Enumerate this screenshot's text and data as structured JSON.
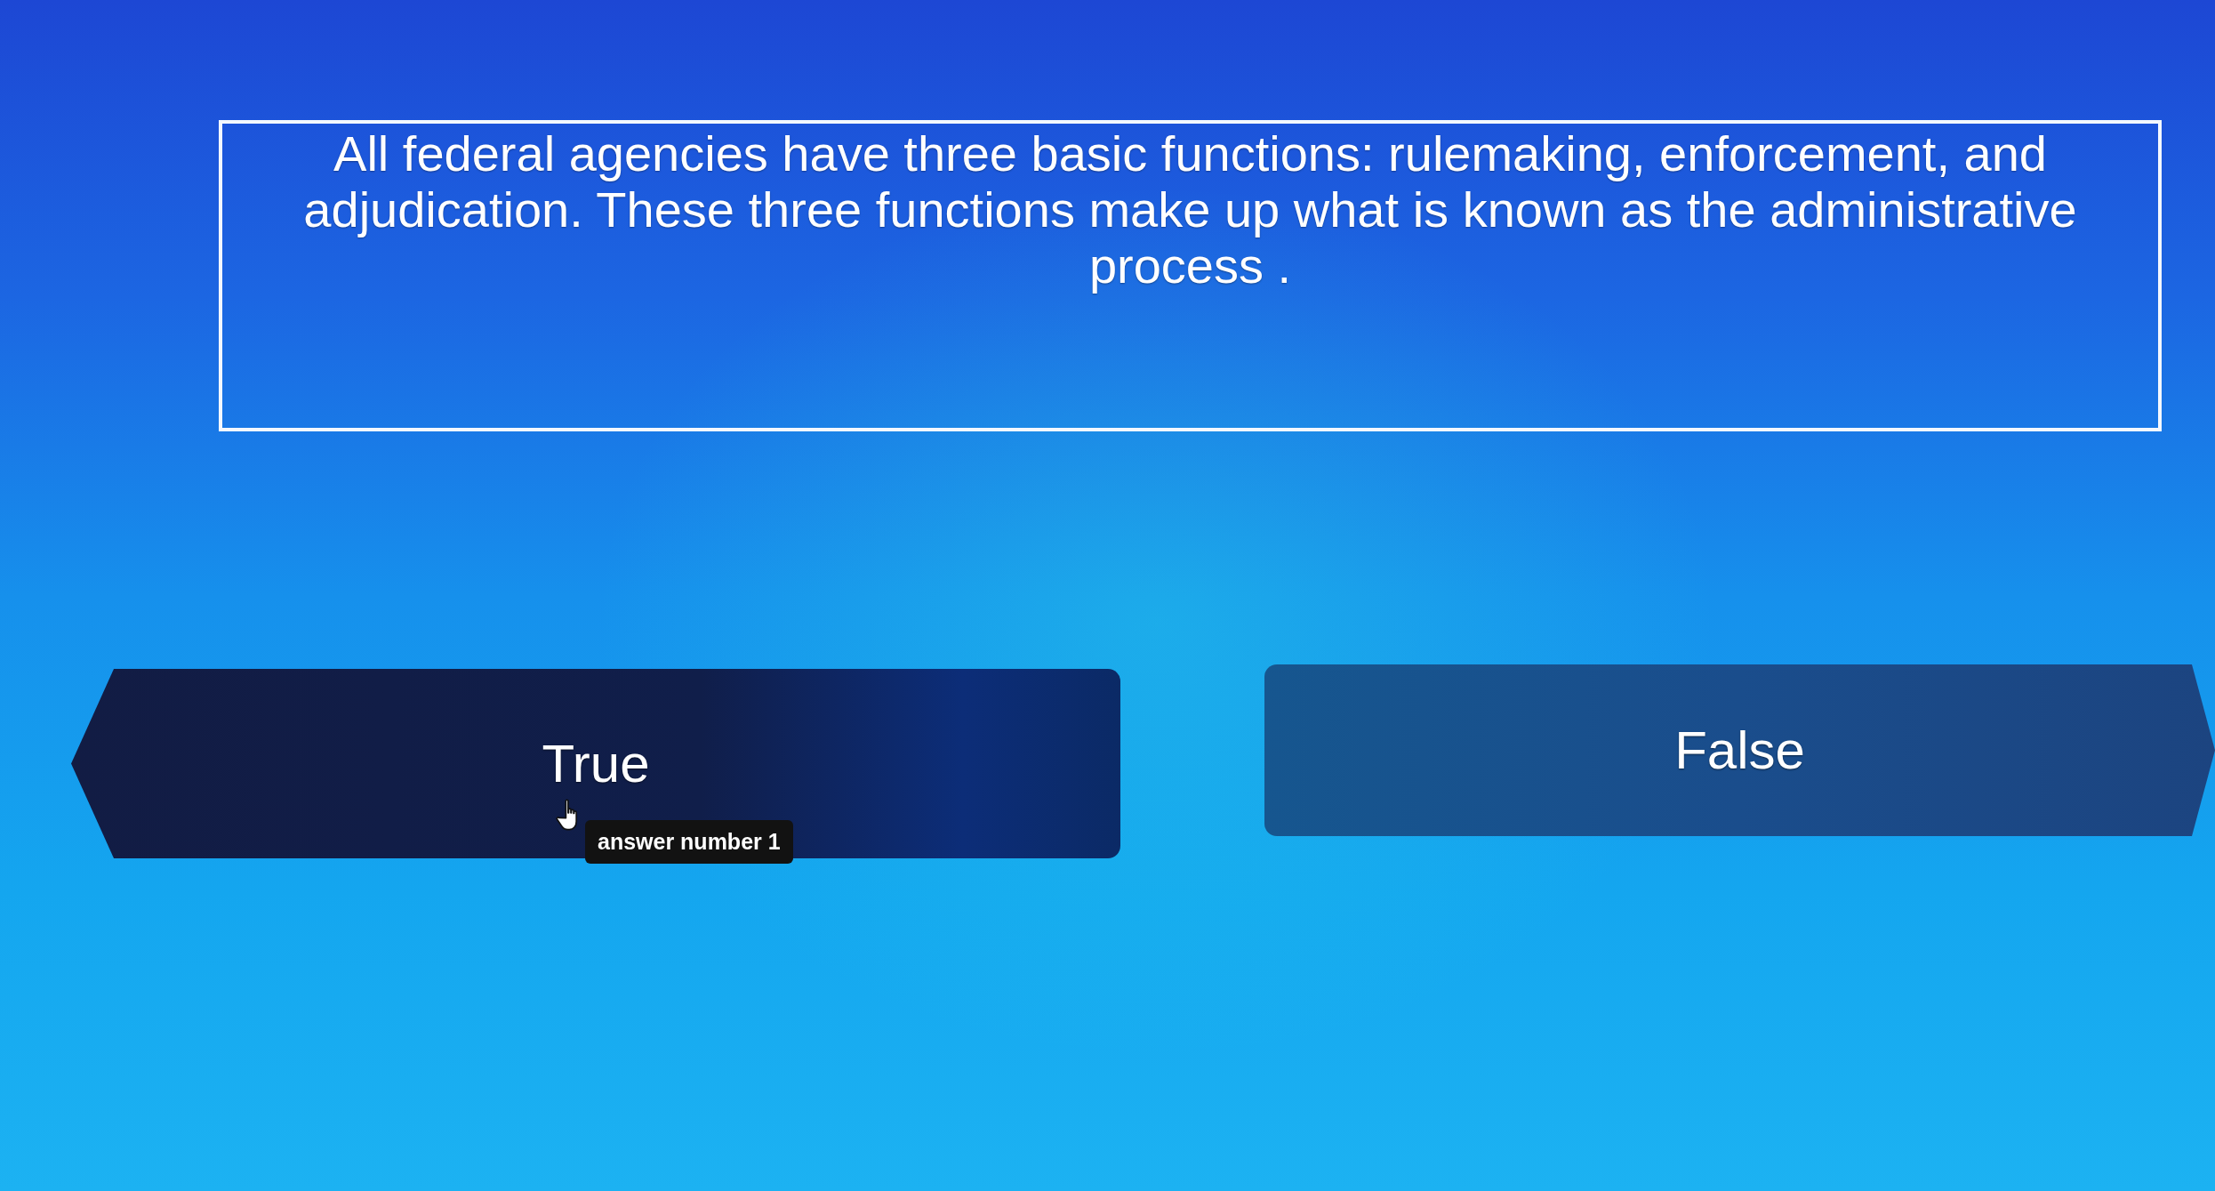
{
  "question": {
    "text": "All federal agencies have three basic functions: rulemaking, enforcement, and adjudication. These three functions make up what is known as the administrative process ."
  },
  "answers": [
    {
      "label": "True",
      "hovered": true,
      "tooltip": "answer number 1"
    },
    {
      "label": "False",
      "hovered": false
    }
  ]
}
